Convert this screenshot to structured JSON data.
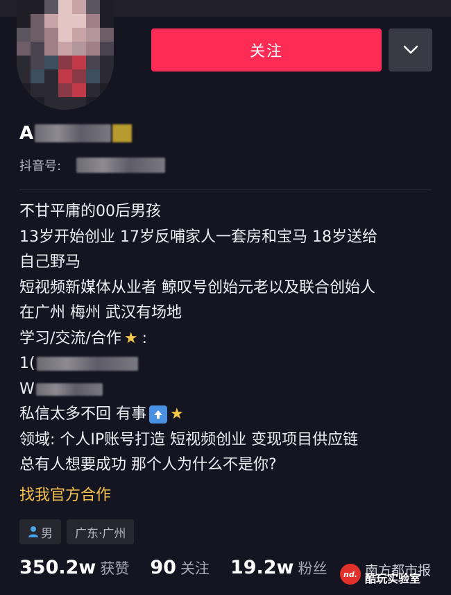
{
  "header": {
    "follow_label": "关注",
    "more_icon": "chevron-down-icon"
  },
  "profile": {
    "nickname_visible": "A",
    "douyin_id_label": "抖音号:"
  },
  "bio": {
    "line1": "不甘平庸的00后男孩",
    "line2": "13岁开始创业 17岁反哺家人一套房和宝马 18岁送给",
    "line3": "自己野马",
    "line4": "短视频新媒体从业者 鲸叹号创始元老以及联合创始人",
    "line5": "在广州 梅州 武汉有场地",
    "line6": "学习/交流/合作",
    "line6_suffix": ":",
    "line7_prefix": "1(",
    "line8_prefix": "W",
    "line9": "私信太多不回 有事",
    "line10": "领域: 个人IP账号打造 短视频创业 变现项目供应链",
    "line11": "总有人想要成功 那个人为什么不是你?"
  },
  "official_link": "找我官方合作",
  "tags": {
    "gender": "男",
    "location": "广东·广州"
  },
  "stats": {
    "likes_value": "350.2w",
    "likes_label": "获赞",
    "following_value": "90",
    "following_label": "关注",
    "followers_value": "19.2w",
    "followers_label": "粉丝"
  },
  "watermark": {
    "logo_text": "nd.",
    "line1": "南方都市报",
    "line2": "酷玩实验室"
  },
  "colors": {
    "background": "#151522",
    "follow_button": "#fe2c55",
    "official_link": "#f5c24d",
    "star": "#f7c948"
  }
}
